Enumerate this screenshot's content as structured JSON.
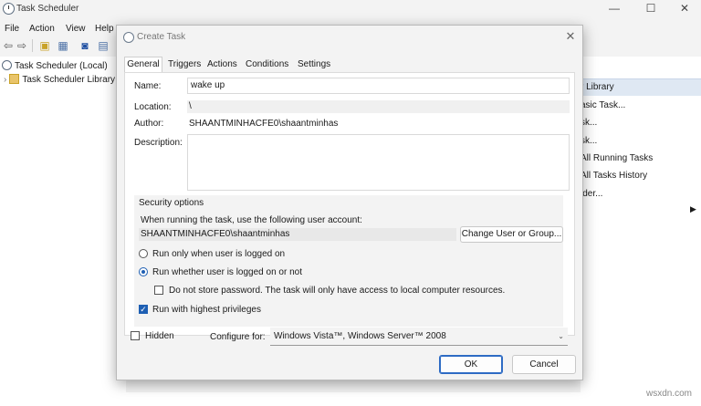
{
  "app": {
    "title": "Task Scheduler",
    "menu": [
      "File",
      "Action",
      "View",
      "Help"
    ],
    "tree": [
      "Task Scheduler (Local)",
      "Task Scheduler Library"
    ],
    "window_buttons": [
      "—",
      "☐",
      "✕"
    ],
    "actions_panel": {
      "header": "r Library",
      "items": [
        "asic Task...",
        "sk...",
        "sk...",
        "All Running Tasks",
        "All Tasks History",
        "lder..."
      ]
    }
  },
  "dialog": {
    "title": "Create Task",
    "tabs": [
      "General",
      "Triggers",
      "Actions",
      "Conditions",
      "Settings"
    ],
    "name_label": "Name:",
    "name_value": "wake up",
    "location_label": "Location:",
    "location_value": "\\",
    "author_label": "Author:",
    "author_value": "SHAANTMINHACFE0\\shaantminhas",
    "description_label": "Description:",
    "description_value": "",
    "security": {
      "title": "Security options",
      "account_prompt": "When running the task, use the following user account:",
      "account_value": "SHAANTMINHACFE0\\shaantminhas",
      "change_button": "Change User or Group...",
      "radio_logged_on": "Run only when user is logged on",
      "radio_whether": "Run whether user is logged on or not",
      "no_store_password": "Do not store password.  The task will only have access to local computer resources.",
      "highest_privileges": "Run with highest privileges"
    },
    "hidden_label": "Hidden",
    "configure_label": "Configure for:",
    "configure_value": "Windows Vista™, Windows Server™ 2008",
    "ok": "OK",
    "cancel": "Cancel"
  },
  "watermark": "wsxdn.com"
}
